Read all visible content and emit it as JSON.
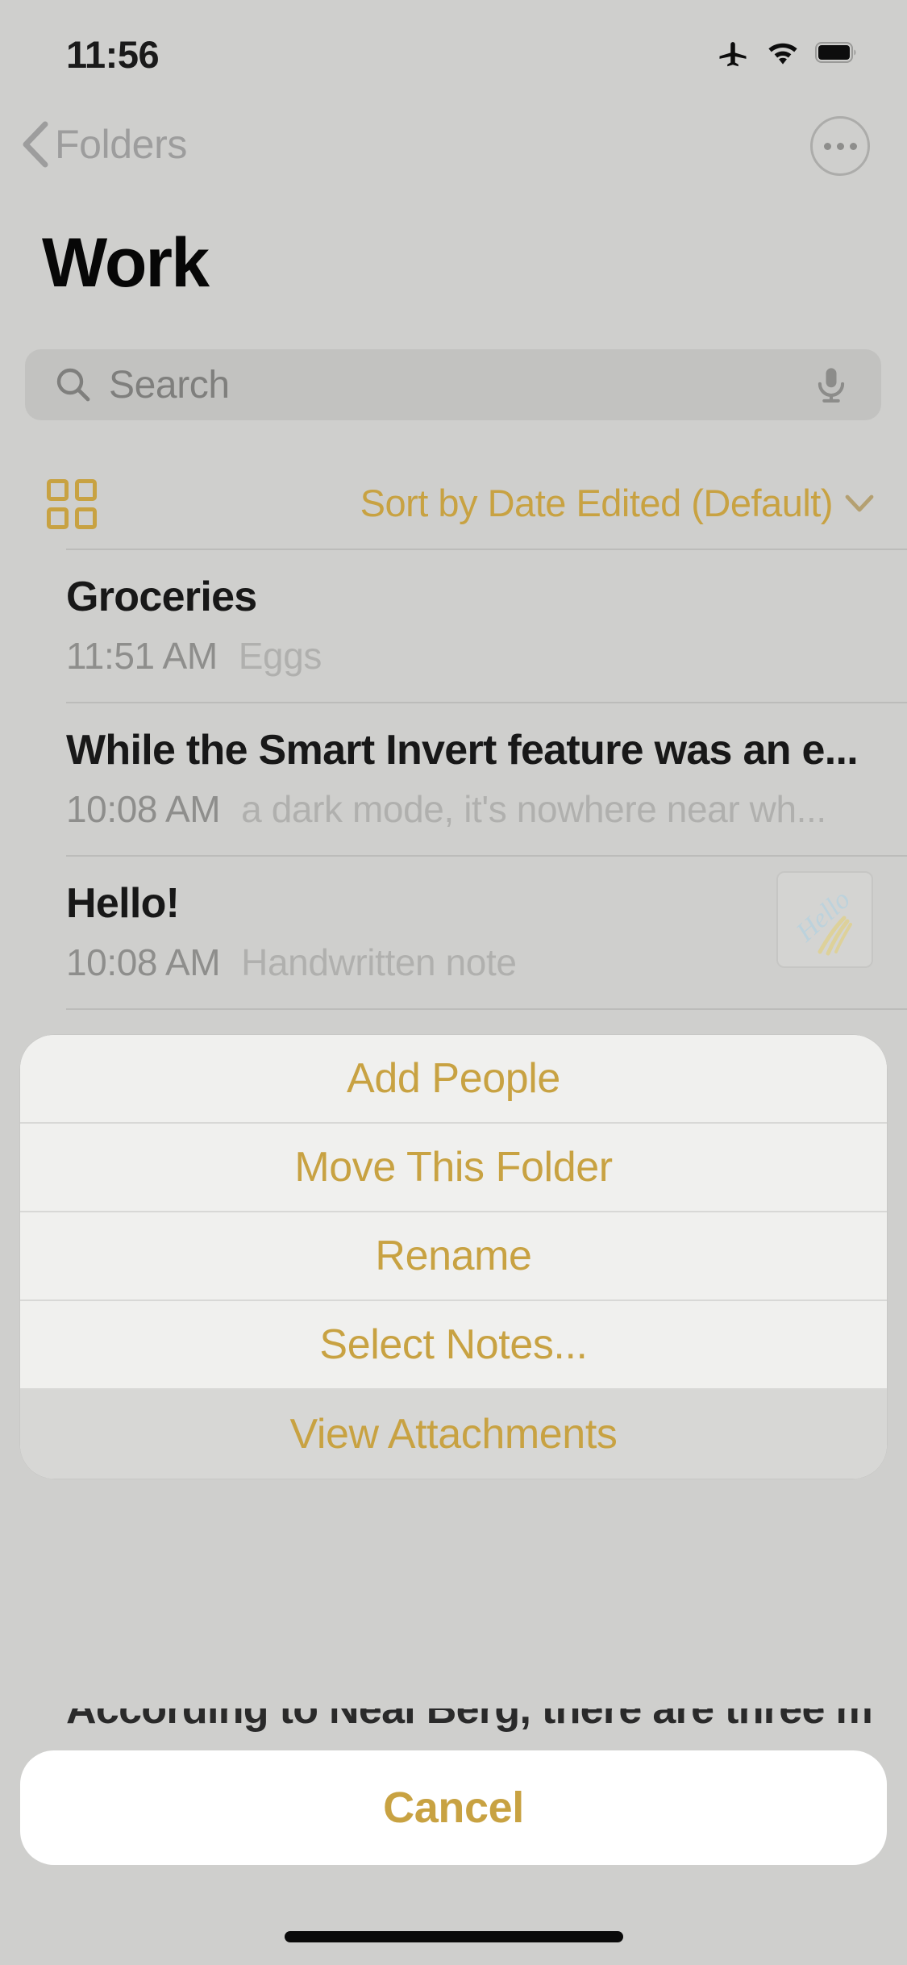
{
  "status_bar": {
    "time": "11:56",
    "icons": [
      "airplane-mode-icon",
      "wifi-icon",
      "battery-icon"
    ]
  },
  "nav_bar": {
    "back_label": "Folders",
    "back_icon": "chevron-left-icon",
    "more_icon": "ellipsis-circle-icon"
  },
  "header": {
    "title": "Work"
  },
  "search": {
    "placeholder": "Search",
    "icon": "search-icon",
    "mic_icon": "microphone-icon"
  },
  "toolbar": {
    "grid_view_icon": "grid-view-icon",
    "sort_label": "Sort by Date Edited (Default)",
    "sort_chevron": "chevron-down-icon"
  },
  "notes": [
    {
      "title": "Groceries",
      "time": "11:51 AM",
      "snippet": "Eggs",
      "has_thumbnail": false
    },
    {
      "title": "While the Smart Invert feature was an e...",
      "time": "10:08 AM",
      "snippet": "a dark mode, it's nowhere near wh...",
      "has_thumbnail": false
    },
    {
      "title": "Hello!",
      "time": "10:08 AM",
      "snippet": "Handwritten note",
      "has_thumbnail": true,
      "thumbnail_alt": "handwritten-hello-sketch"
    }
  ],
  "background_note_peek": "According to Neal Berg, there are three m...",
  "action_sheet": {
    "items": [
      {
        "label": "Add People",
        "pressed": false
      },
      {
        "label": "Move This Folder",
        "pressed": false
      },
      {
        "label": "Rename",
        "pressed": false
      },
      {
        "label": "Select Notes...",
        "pressed": false
      },
      {
        "label": "View Attachments",
        "pressed": true
      }
    ],
    "cancel_label": "Cancel"
  },
  "colors": {
    "accent_gold": "#c8a242",
    "page_background": "#cfcfcd",
    "sheet_background": "#f0f0ee",
    "cancel_background": "#ffffff",
    "title_text": "#070707",
    "secondary_text": "#8e8e8c",
    "tertiary_text": "#b0b0ae"
  }
}
